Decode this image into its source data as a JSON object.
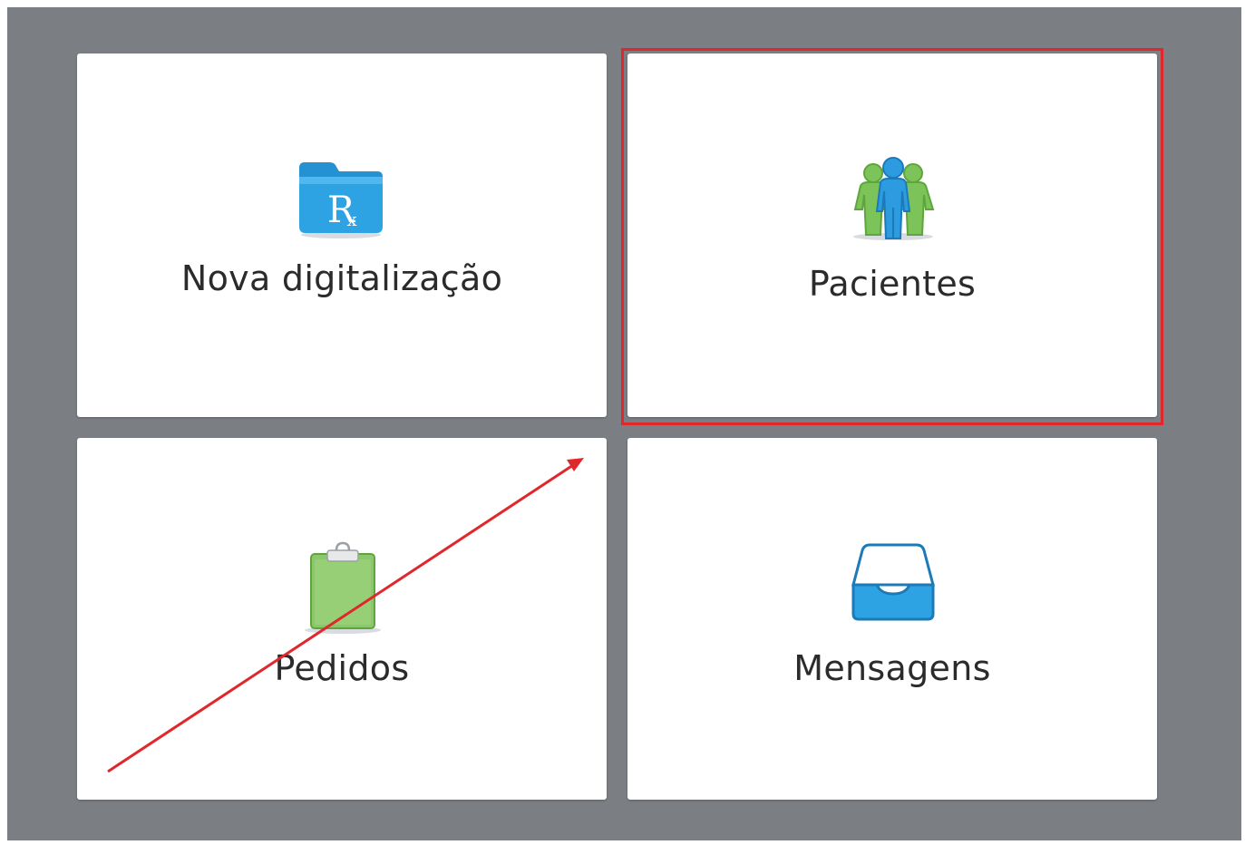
{
  "tiles": {
    "nova": {
      "label": "Nova digitalização",
      "icon": "rx-folder-icon"
    },
    "pacientes": {
      "label": "Pacientes",
      "icon": "patients-icon"
    },
    "pedidos": {
      "label": "Pedidos",
      "icon": "clipboard-icon"
    },
    "mensagens": {
      "label": "Mensagens",
      "icon": "inbox-tray-icon"
    }
  },
  "colors": {
    "background": "#7b7e83",
    "tile": "#ffffff",
    "highlight": "#e0282c",
    "folder_blue": "#2ea3e3",
    "patient_green": "#7cc35a",
    "patient_blue": "#2d9be0",
    "clipboard_green": "#8cc86b",
    "tray_blue": "#2ea3e3"
  },
  "annotations": {
    "highlight_target": "pacientes",
    "arrow_color": "#e0282c"
  }
}
